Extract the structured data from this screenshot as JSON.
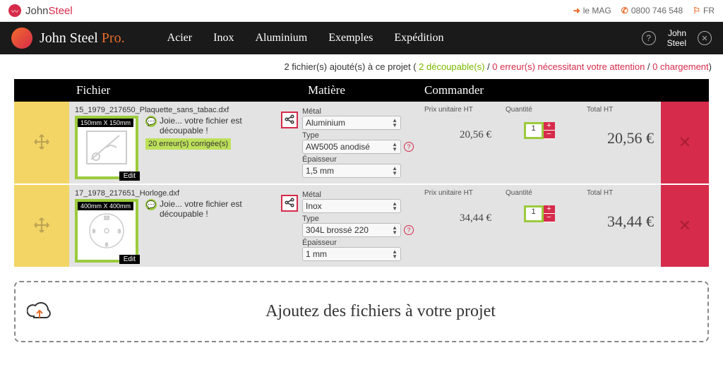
{
  "top": {
    "brand_a": "John",
    "brand_b": "Steel",
    "mag": "le MAG",
    "phone": "0800 746 548",
    "lang": "FR"
  },
  "main": {
    "title_a": "John Steel ",
    "title_b": "Pro.",
    "nav": {
      "acier": "Acier",
      "inox": "Inox",
      "aluminium": "Aluminium",
      "exemples": "Exemples",
      "expedition": "Expédition"
    },
    "user1": "John",
    "user2": "Steel"
  },
  "status": {
    "pre": "2 fichier(s) ajouté(s) à ce projet ( ",
    "decoupables": "2 découpable(s)",
    "sep1": " / ",
    "erreurs": "0 erreur(s) nécessitant votre attention",
    "sep2": " / ",
    "chargement": "0 chargement",
    "post": ")"
  },
  "headers": {
    "fichier": "Fichier",
    "matiere": "Matière",
    "commander": "Commander"
  },
  "labels": {
    "metal": "Métal",
    "type": "Type",
    "epaisseur": "Épaisseur",
    "prix": "Prix unitaire HT",
    "qte": "Quantité",
    "total": "Total HT",
    "ok_msg": "Joie... votre fichier est découpable !",
    "edit": "Edit"
  },
  "rows": [
    {
      "filename": "15_1979_217650_Plaquette_sans_tabac.dxf",
      "dims": "150mm X 150mm",
      "corrections": "20 erreur(s) corrigée(s)",
      "metal": "Aluminium",
      "type": "AW5005 anodisé",
      "epaisseur": "1,5 mm",
      "prix": "20,56 €",
      "qty": "1",
      "total": "20,56 €"
    },
    {
      "filename": "17_1978_217651_Horloge.dxf",
      "dims": "400mm X 400mm",
      "corrections": "",
      "metal": "Inox",
      "type": "304L brossé 220",
      "epaisseur": "1 mm",
      "prix": "34,44 €",
      "qty": "1",
      "total": "34,44 €"
    }
  ],
  "dropzone": "Ajoutez des fichiers à votre projet"
}
